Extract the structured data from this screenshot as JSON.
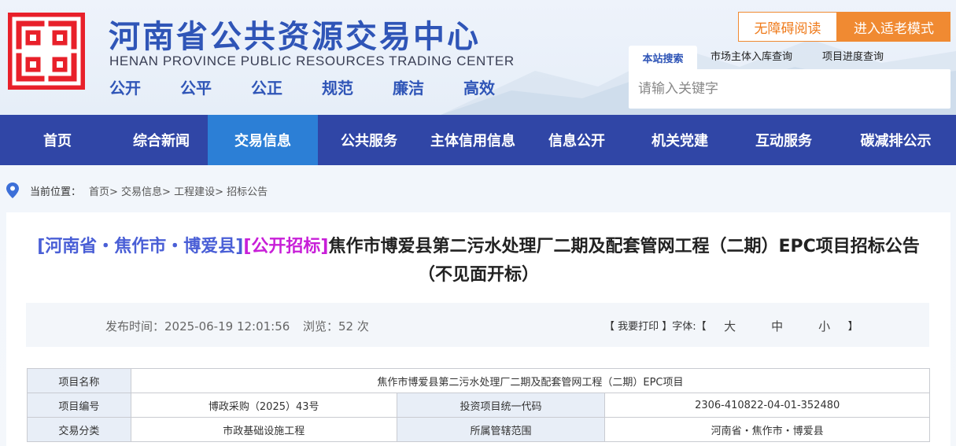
{
  "header": {
    "title": "河南省公共资源交易中心",
    "title_en": "HENAN PROVINCE PUBLIC RESOURCES TRADING CENTER",
    "slogans": [
      "公开",
      "公平",
      "公正",
      "规范",
      "廉洁",
      "高效"
    ],
    "accessibility_label": "无障碍阅读",
    "elder_mode_label": "进入适老模式",
    "search_tab": "本站搜索",
    "links": [
      "市场主体入库查询",
      "项目进度查询"
    ],
    "search_placeholder": "请输入关键字",
    "brand_color": "#2f55b7",
    "accent_color": "#f08a32"
  },
  "nav": {
    "items": [
      "首页",
      "综合新闻",
      "交易信息",
      "公共服务",
      "主体信用信息",
      "信息公开",
      "机关党建",
      "互动服务",
      "碳减排公示"
    ],
    "active": "交易信息",
    "bg_color": "#3046a6",
    "active_color": "#2c7fd6"
  },
  "breadcrumb": {
    "label": "当前位置：",
    "path": "首页> 交易信息> 工程建设> 招标公告"
  },
  "notice": {
    "region_tag": "[河南省・焦作市・博爱县]",
    "type_tag": "[公开招标]",
    "title": "焦作市博爱县第二污水处理厂二期及配套管网工程（二期）EPC项目招标公告（不见面开标）",
    "publish_time": "发布时间：2025-06-19 12:01:56",
    "views": "浏览：52 次",
    "print": "【 我要打印 】",
    "font_size_label": "字体:【",
    "font_sizes": [
      "大",
      "中",
      "小"
    ],
    "font_close": "】"
  },
  "info_table": {
    "rows": [
      {
        "label": "项目名称",
        "value": "焦作市博爱县第二污水处理厂二期及配套管网工程（二期）EPC项目"
      },
      {
        "label": "项目编号",
        "value": "博政采购（2025）43号",
        "label2": "投资项目统一代码",
        "value2": "2306-410822-04-01-352480"
      },
      {
        "label": "交易分类",
        "value": "市政基础设施工程",
        "label2": "所属管辖范围",
        "value2": "河南省・焦作市・博爱县"
      }
    ]
  }
}
